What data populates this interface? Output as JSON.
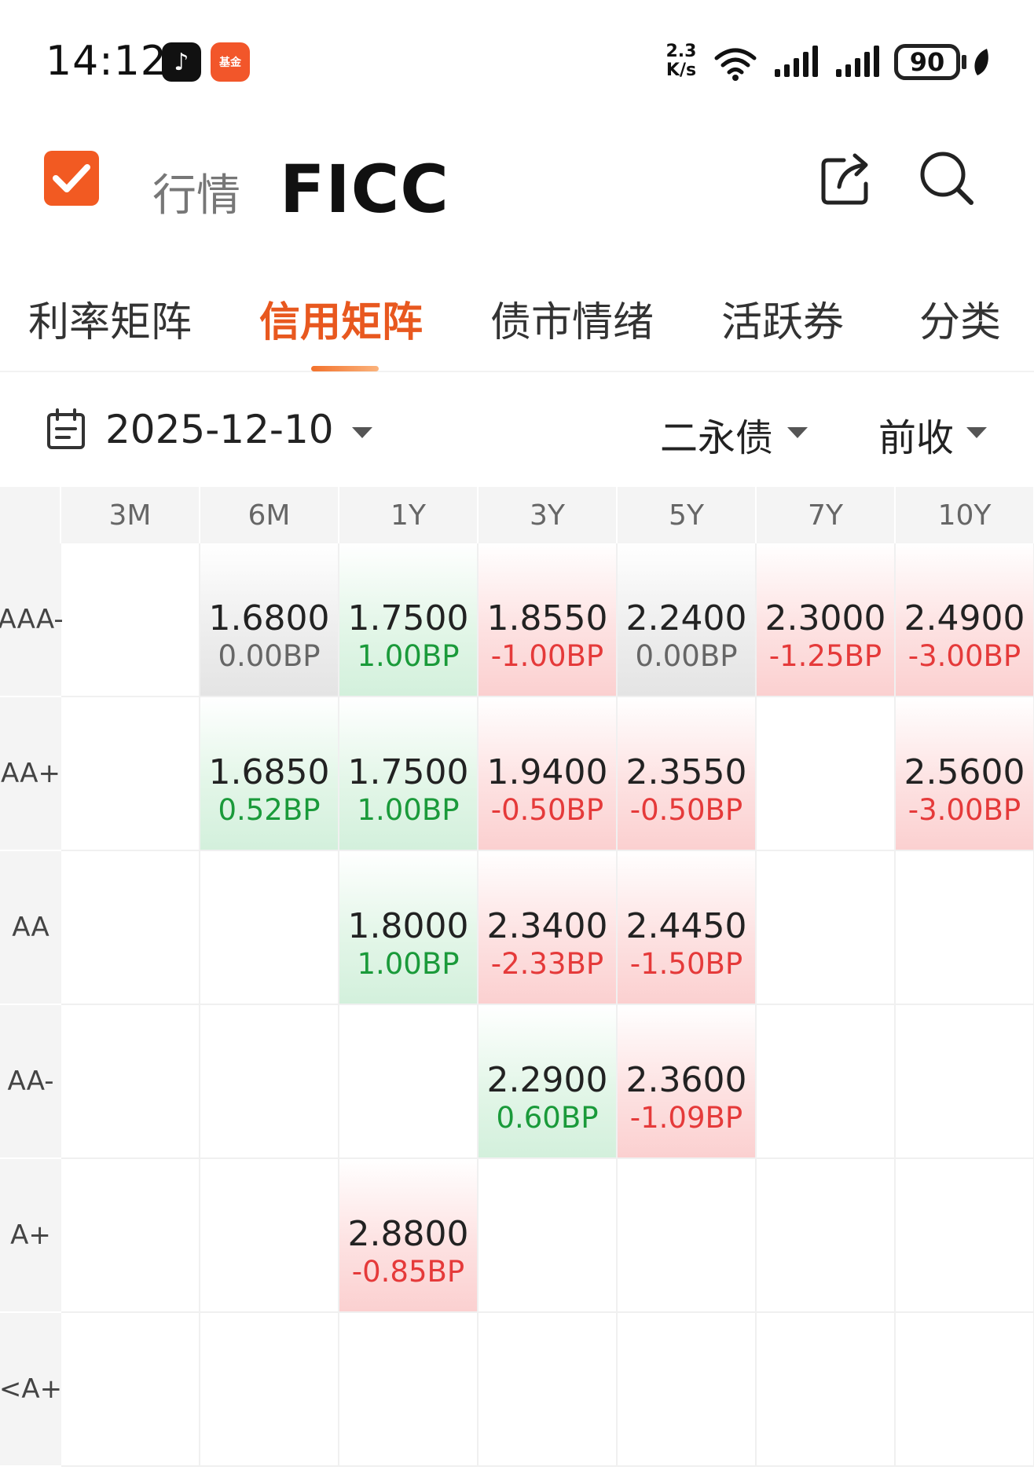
{
  "status_bar": {
    "time": "14:12",
    "fund_app_label": "基金",
    "net_speed_value": "2.3",
    "net_speed_unit": "K/s",
    "battery": "90"
  },
  "header": {
    "subtitle": "行情",
    "title": "FICC"
  },
  "tabs": [
    {
      "label": "利率矩阵",
      "active": false
    },
    {
      "label": "信用矩阵",
      "active": true
    },
    {
      "label": "债市情绪",
      "active": false
    },
    {
      "label": "活跃券",
      "active": false
    },
    {
      "label": "分类",
      "active": false
    }
  ],
  "filters": {
    "date": "2025-12-10",
    "bond_type": "二永债",
    "compare": "前收"
  },
  "colors": {
    "accent": "#e8581f",
    "up": "#e53a3a",
    "down": "#1a9a3a"
  },
  "matrix": {
    "columns": [
      "3M",
      "6M",
      "1Y",
      "3Y",
      "5Y",
      "7Y",
      "10Y"
    ],
    "rows": [
      {
        "rating": "AAA-",
        "cells": [
          null,
          {
            "value": "1.6800",
            "change": "0.00BP",
            "dir": "flat"
          },
          {
            "value": "1.7500",
            "change": "1.00BP",
            "dir": "down"
          },
          {
            "value": "1.8550",
            "change": "-1.00BP",
            "dir": "up"
          },
          {
            "value": "2.2400",
            "change": "0.00BP",
            "dir": "flat"
          },
          {
            "value": "2.3000",
            "change": "-1.25BP",
            "dir": "up"
          },
          {
            "value": "2.4900",
            "change": "-3.00BP",
            "dir": "up"
          }
        ]
      },
      {
        "rating": "AA+",
        "cells": [
          null,
          {
            "value": "1.6850",
            "change": "0.52BP",
            "dir": "down"
          },
          {
            "value": "1.7500",
            "change": "1.00BP",
            "dir": "down"
          },
          {
            "value": "1.9400",
            "change": "-0.50BP",
            "dir": "up"
          },
          {
            "value": "2.3550",
            "change": "-0.50BP",
            "dir": "up"
          },
          null,
          {
            "value": "2.5600",
            "change": "-3.00BP",
            "dir": "up"
          }
        ]
      },
      {
        "rating": "AA",
        "cells": [
          null,
          null,
          {
            "value": "1.8000",
            "change": "1.00BP",
            "dir": "down"
          },
          {
            "value": "2.3400",
            "change": "-2.33BP",
            "dir": "up"
          },
          {
            "value": "2.4450",
            "change": "-1.50BP",
            "dir": "up"
          },
          null,
          null
        ]
      },
      {
        "rating": "AA-",
        "cells": [
          null,
          null,
          null,
          {
            "value": "2.2900",
            "change": "0.60BP",
            "dir": "down"
          },
          {
            "value": "2.3600",
            "change": "-1.09BP",
            "dir": "up"
          },
          null,
          null
        ]
      },
      {
        "rating": "A+",
        "cells": [
          null,
          null,
          {
            "value": "2.8800",
            "change": "-0.85BP",
            "dir": "up"
          },
          null,
          null,
          null,
          null
        ]
      },
      {
        "rating": "<A+",
        "cells": [
          null,
          null,
          null,
          null,
          null,
          null,
          null
        ]
      }
    ]
  }
}
